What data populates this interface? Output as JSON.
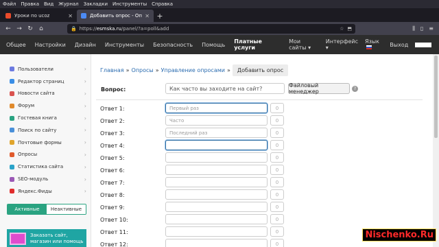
{
  "menubar": [
    "Файл",
    "Правка",
    "Вид",
    "Журнал",
    "Закладки",
    "Инструменты",
    "Справка"
  ],
  "tabs": [
    {
      "label": "Уроки по ucoz",
      "icon_color": "#ea4b2b"
    },
    {
      "label": "Добавить опрос - Опросы - П",
      "icon_color": "#4c8bf5"
    }
  ],
  "url": {
    "domain": "esmska.ru",
    "path": "/panel/?a=poll&add"
  },
  "sitenav": {
    "items": [
      "Общее",
      "Настройки",
      "Дизайн",
      "Инструменты",
      "Безопасность",
      "Помощь"
    ],
    "bold_item": "Платные услуги",
    "right": [
      "Мои сайты",
      "Интерфейс",
      "Язык",
      "Выход"
    ]
  },
  "sidebar": {
    "items": [
      {
        "label": "Пользователи",
        "color": "#6c7ae0"
      },
      {
        "label": "Редактор страниц",
        "color": "#3a8ee6"
      },
      {
        "label": "Новости сайта",
        "color": "#d9534f"
      },
      {
        "label": "Форум",
        "color": "#e08a2c"
      },
      {
        "label": "Гостевая книга",
        "color": "#2aa381"
      },
      {
        "label": "Поиск по сайту",
        "color": "#4a90d9"
      },
      {
        "label": "Почтовые формы",
        "color": "#e0a52c"
      },
      {
        "label": "Опросы",
        "color": "#e05a2c"
      },
      {
        "label": "Статистика сайта",
        "color": "#2aa3c9"
      },
      {
        "label": "SEO-модуль",
        "color": "#9b59b6"
      },
      {
        "label": "Яндекс.Фиды",
        "color": "#e02c2c"
      }
    ],
    "segment": {
      "active": "Активные",
      "inactive": "Неактивные"
    },
    "promo": "Заказать сайт, магазин или помощь"
  },
  "breadcrumbs": [
    "Главная",
    "Опросы",
    "Управление опросами"
  ],
  "breadcrumb_current": "Добавить опрос",
  "question": {
    "label": "Вопрос:",
    "placeholder": "Как часто вы заходите на сайт?"
  },
  "file_manager": "Файловый менеджер",
  "help_icon": "?",
  "answers": [
    {
      "label": "Ответ 1:",
      "placeholder": "Первый раз",
      "count": "0",
      "focus": true
    },
    {
      "label": "Ответ 2:",
      "placeholder": "Часто",
      "count": "0"
    },
    {
      "label": "Ответ 3:",
      "placeholder": "Последний раз",
      "count": "0"
    },
    {
      "label": "Ответ 4:",
      "placeholder": "",
      "count": "0",
      "focus": true
    },
    {
      "label": "Ответ 5:",
      "placeholder": "",
      "count": "0"
    },
    {
      "label": "Ответ 6:",
      "placeholder": "",
      "count": "0"
    },
    {
      "label": "Ответ 7:",
      "placeholder": "",
      "count": "0"
    },
    {
      "label": "Ответ 8:",
      "placeholder": "",
      "count": "0"
    },
    {
      "label": "Ответ 9:",
      "placeholder": "",
      "count": "0"
    },
    {
      "label": "Ответ 10:",
      "placeholder": "",
      "count": "0"
    },
    {
      "label": "Ответ 11:",
      "placeholder": "",
      "count": "0"
    },
    {
      "label": "Ответ 12:",
      "placeholder": "",
      "count": "0"
    }
  ],
  "watermark": "Nischenko.Ru"
}
